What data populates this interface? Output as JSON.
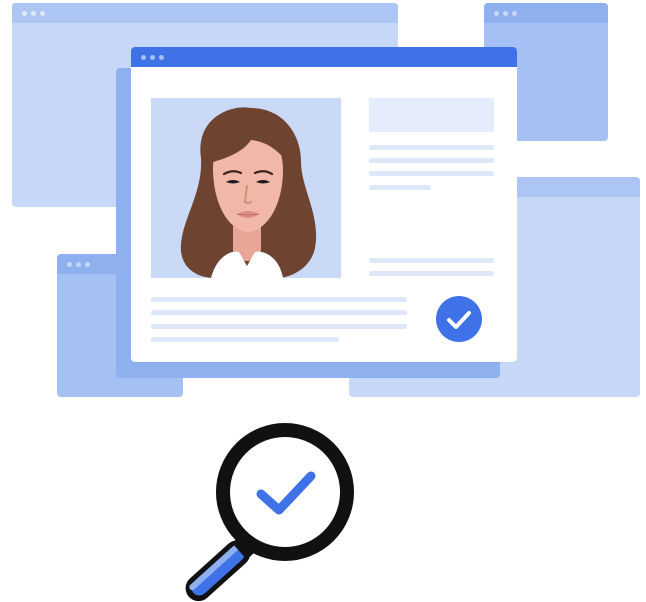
{
  "colors": {
    "pale_window": "#c6d7f7",
    "pale_bar": "#adc5f2",
    "mid_window": "#a5c0f3",
    "mid_bar": "#8fb0ee",
    "accent": "#3f72e6",
    "card_bg": "#ffffff",
    "photo_bg": "#c9d9f6",
    "text_line": "#dfe8fb",
    "header_block": "#e5edfc",
    "hair": "#6e4330",
    "skin": "#f2b8a7",
    "outline": "#111111"
  },
  "verification": {
    "badge_icon": "check-circle-icon",
    "magnifier_icon": "magnifier-check-icon"
  }
}
